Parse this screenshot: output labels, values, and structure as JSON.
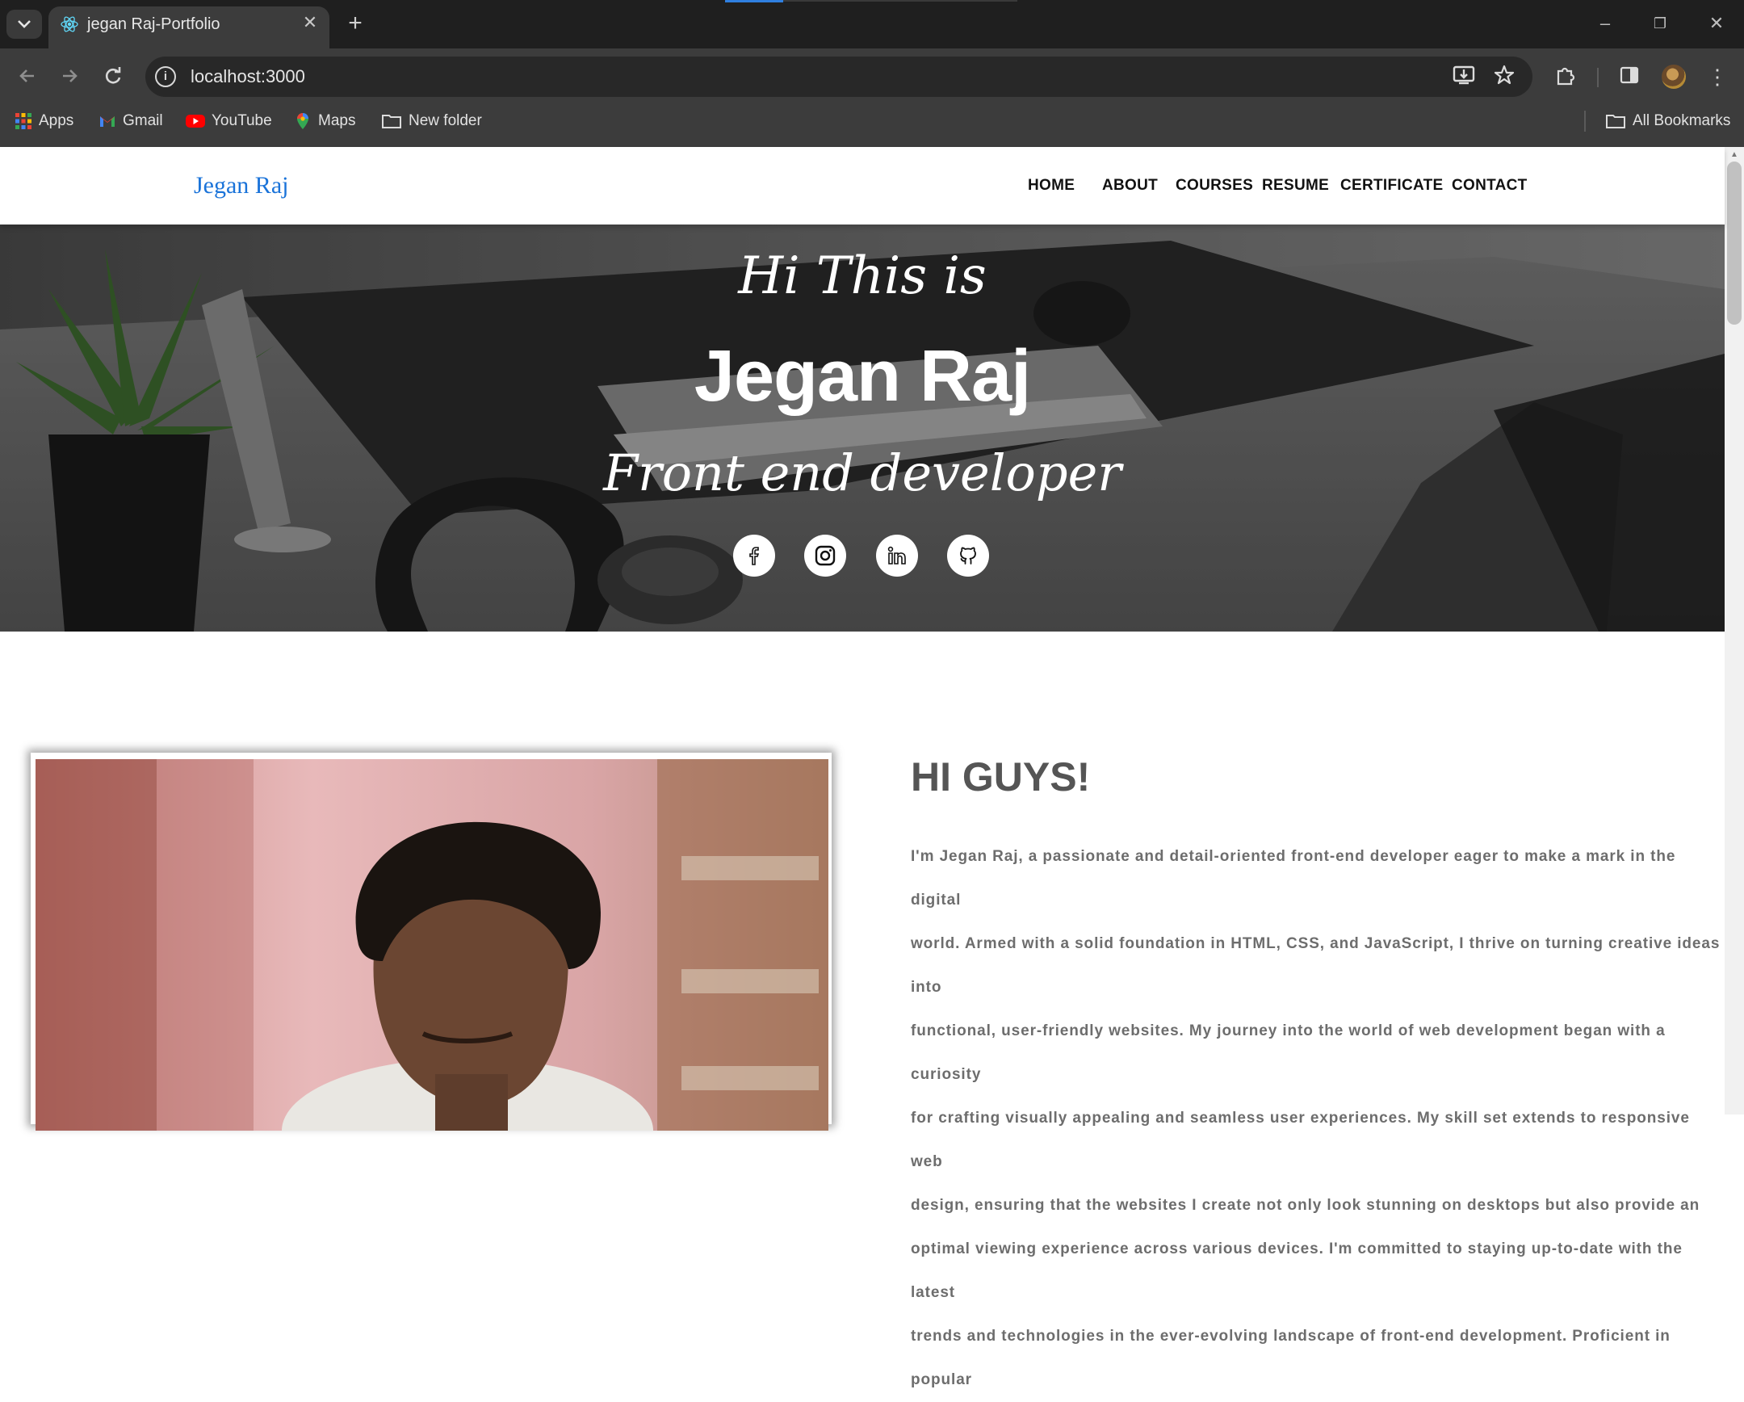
{
  "browser": {
    "tab_title": "jegan Raj-Portfolio",
    "url": "localhost:3000",
    "bookmarks": [
      "Apps",
      "Gmail",
      "YouTube",
      "Maps",
      "New folder"
    ],
    "all_bookmarks": "All Bookmarks"
  },
  "site": {
    "brand": "Jegan Raj",
    "nav": [
      "HOME",
      "ABOUT",
      "COURSES",
      "RESUME",
      "CERTIFICATE",
      "CONTACT"
    ]
  },
  "hero": {
    "greeting": "Hi This is",
    "name": "Jegan Raj",
    "role": "Front end developer",
    "socials": [
      "facebook-icon",
      "instagram-icon",
      "linkedin-icon",
      "github-icon"
    ]
  },
  "about": {
    "heading": "HI GUYS!",
    "lines": [
      "I'm Jegan Raj, a passionate and detail-oriented front-end developer eager to make a mark in the digital",
      "world. Armed with a solid foundation in HTML, CSS, and JavaScript, I thrive on turning creative ideas into",
      "functional, user-friendly websites. My journey into the world of web development began with a curiosity",
      "for crafting visually appealing and seamless user experiences. My skill set extends to responsive web",
      "design, ensuring that the websites I create not only look stunning on desktops but also provide an",
      "optimal viewing experience across various devices. I'm committed to staying up-to-date with the latest",
      "trends and technologies in the ever-evolving landscape of front-end development. Proficient in popular"
    ]
  },
  "colors": {
    "brand_blue": "#1a73d9",
    "chrome_dark": "#3c3c3c"
  }
}
